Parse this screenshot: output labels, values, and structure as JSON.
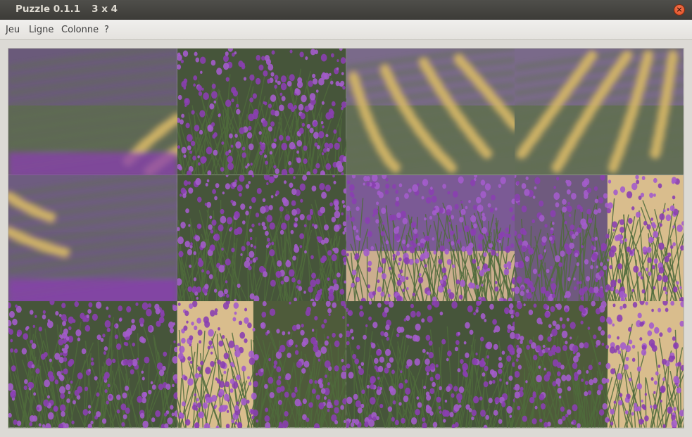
{
  "window": {
    "app_title": "Puzzle 0.1.1",
    "grid_label": "3 x 4",
    "close_glyph": "×"
  },
  "menu": {
    "items": [
      {
        "label": "Jeu"
      },
      {
        "label": "Ligne"
      },
      {
        "label": "Colonne"
      },
      {
        "label": "?"
      }
    ]
  },
  "board": {
    "rows": 3,
    "cols": 4,
    "tiles": [
      {
        "id": 1,
        "kind": "blurred-field-stripes-left"
      },
      {
        "id": 2,
        "kind": "lavender-bush-closeup"
      },
      {
        "id": 3,
        "kind": "blurred-field-yellow-stripes"
      },
      {
        "id": 4,
        "kind": "blurred-field-yellow-stripes-right"
      },
      {
        "id": 5,
        "kind": "blurred-field-purple"
      },
      {
        "id": 6,
        "kind": "lavender-bush-top"
      },
      {
        "id": 7,
        "kind": "blurred-bush-with-sand"
      },
      {
        "id": 8,
        "kind": "blurred-bush-right"
      },
      {
        "id": 9,
        "kind": "lavender-bush-dark"
      },
      {
        "id": 10,
        "kind": "lavender-bush-sand-left"
      },
      {
        "id": 11,
        "kind": "lavender-bush-dense"
      },
      {
        "id": 12,
        "kind": "lavender-bush-sand-right"
      }
    ]
  },
  "colors": {
    "lavender": "#8a3fb0",
    "lavender_light": "#a35ccb",
    "stem_green": "#4f6b3c",
    "field_green": "#5f6e4e",
    "sand": "#d9bd8d",
    "stripe_yellow": "#d7b867"
  }
}
